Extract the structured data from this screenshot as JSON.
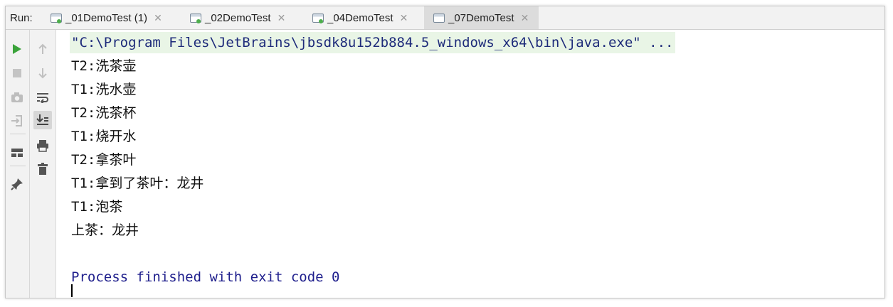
{
  "run_panel": {
    "label": "Run:",
    "tabs": [
      {
        "label": "_01DemoTest (1)",
        "active": false
      },
      {
        "label": "_02DemoTest",
        "active": false
      },
      {
        "label": "_04DemoTest",
        "active": false
      },
      {
        "label": "_07DemoTest",
        "active": true
      }
    ]
  },
  "toolbar_left": [
    "run-icon",
    "stop-icon",
    "camera-icon",
    "exit-icon",
    "layout-icon",
    "pin-icon"
  ],
  "toolbar_right": [
    "up-arrow-icon",
    "down-arrow-icon",
    "soft-wrap-icon",
    "scroll-to-end-icon",
    "print-icon",
    "trash-icon"
  ],
  "console": {
    "command": "\"C:\\Program Files\\JetBrains\\jbsdk8u152b884.5_windows_x64\\bin\\java.exe\" ...",
    "lines": [
      "T2:洗茶壶",
      "T1:洗水壶",
      "T2:洗茶杯",
      "T1:烧开水",
      "T2:拿茶叶",
      "T1:拿到了茶叶：龙井",
      "T1:泡茶",
      "上茶：龙井"
    ],
    "finished": "Process finished with exit code 0"
  },
  "colors": {
    "command_bg": "#e9f5e6",
    "command_text": "#1e2b7a",
    "finished_text": "#1e1e8c",
    "run_green": "#3aa33a"
  }
}
